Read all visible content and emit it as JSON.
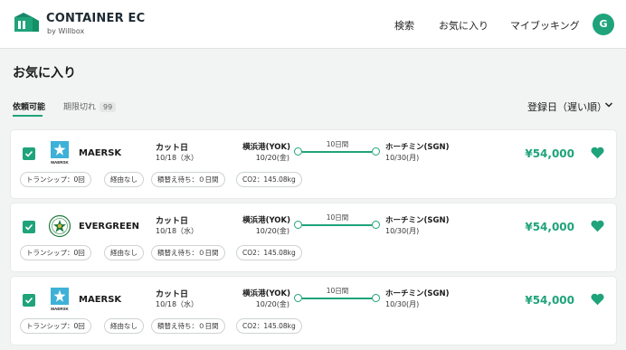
{
  "brand": {
    "title": "CONTAINER EC",
    "subtitle": "by Willbox"
  },
  "nav": {
    "search": "検索",
    "favorites": "お気に入り",
    "my_booking": "マイブッキング",
    "avatar_initial": "G"
  },
  "page": {
    "title": "お気に入り"
  },
  "tabs": {
    "available": "依頼可能",
    "expired": "期限切れ",
    "expired_count": "99"
  },
  "sort": {
    "label": "登録日（遅い順）"
  },
  "colors": {
    "accent": "#1fa37a",
    "maersk": "#3eb1d8",
    "evergreen": "#1c7a3c"
  },
  "cards": [
    {
      "carrier": "MAERSK",
      "carrier_logo_caption": "MAERSK",
      "logo_icon": "maersk-star-icon",
      "cut_label": "カット日",
      "cut_date": "10/18（水）",
      "origin_port": "横浜港(YOK)",
      "origin_date": "10/20(金)",
      "transit_days": "10日間",
      "dest_port": "ホーチミン(SGN)",
      "dest_date": "10/30(月)",
      "price": "¥54,000",
      "tags": [
        "トランシップ：0回",
        "経由なし",
        "積替え待ち：０日間",
        "CO2：145.08kg"
      ]
    },
    {
      "carrier": "EVERGREEN",
      "carrier_logo_caption": "",
      "logo_icon": "evergreen-emblem-icon",
      "cut_label": "カット日",
      "cut_date": "10/18（水）",
      "origin_port": "横浜港(YOK)",
      "origin_date": "10/20(金)",
      "transit_days": "10日間",
      "dest_port": "ホーチミン(SGN)",
      "dest_date": "10/30(月)",
      "price": "¥54,000",
      "tags": [
        "トランシップ：0回",
        "経由なし",
        "積替え待ち：０日間",
        "CO2：145.08kg"
      ]
    },
    {
      "carrier": "MAERSK",
      "carrier_logo_caption": "MAERSK",
      "logo_icon": "maersk-star-icon",
      "cut_label": "カット日",
      "cut_date": "10/18（水）",
      "origin_port": "横浜港(YOK)",
      "origin_date": "10/20(金)",
      "transit_days": "10日間",
      "dest_port": "ホーチミン(SGN)",
      "dest_date": "10/30(月)",
      "price": "¥54,000",
      "tags": [
        "トランシップ：0回",
        "経由なし",
        "積替え待ち：０日間",
        "CO2：145.08kg"
      ]
    }
  ]
}
